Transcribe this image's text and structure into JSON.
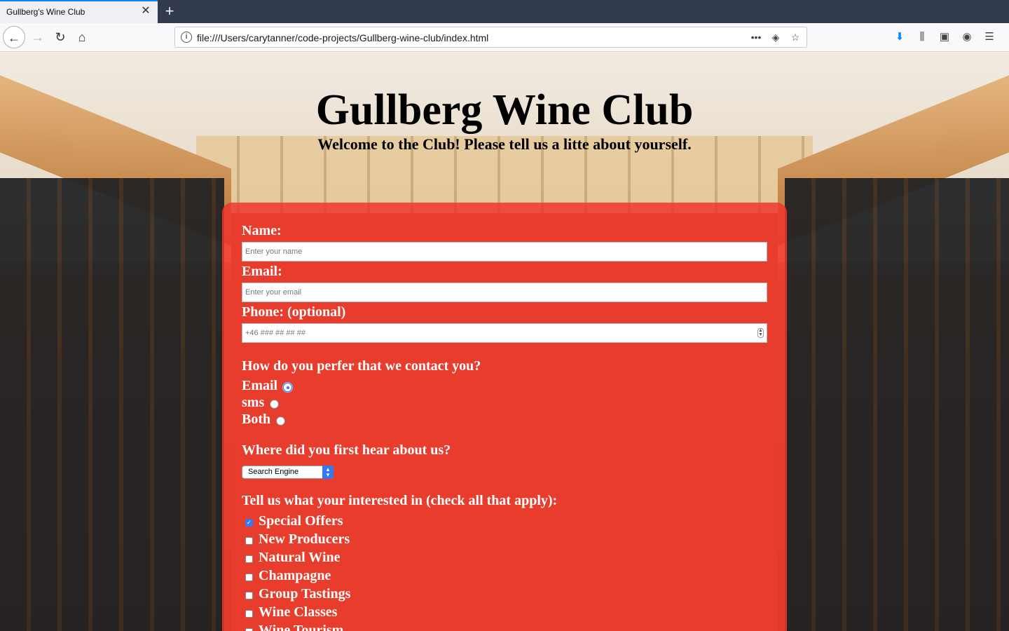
{
  "browser": {
    "tab_title": "Gullberg's Wine Club",
    "tab_close": "✕",
    "new_tab": "+",
    "url": "file:///Users/carytanner/code-projects/Gullberg-wine-club/index.html",
    "icons": {
      "back": "←",
      "forward": "→",
      "reload": "↻",
      "home": "⌂",
      "info": "i",
      "more": "•••",
      "pocket": "◈",
      "bookmark": "☆",
      "download": "⬇",
      "library": "⫼",
      "sidebar": "▣",
      "account": "◉",
      "menu": "☰"
    }
  },
  "page": {
    "title": "Gullberg Wine Club",
    "subtitle": "Welcome to the Club! Please tell us a litte about yourself."
  },
  "form": {
    "name_label": "Name:",
    "name_placeholder": "Enter your name",
    "email_label": "Email:",
    "email_placeholder": "Enter your email",
    "phone_label": "Phone: (optional)",
    "phone_placeholder": "+46 ### ## ## ##",
    "contact_question": "How do you perfer that we contact you?",
    "contact_options": [
      {
        "label": "Email",
        "selected": true
      },
      {
        "label": "sms",
        "selected": false
      },
      {
        "label": "Both",
        "selected": false
      }
    ],
    "source_question": "Where did you first hear about us?",
    "source_selected": "Search Engine",
    "interests_question": "Tell us what your interested in (check all that apply):",
    "interests": [
      {
        "label": "Special Offers",
        "checked": true
      },
      {
        "label": "New Producers",
        "checked": false
      },
      {
        "label": "Natural Wine",
        "checked": false
      },
      {
        "label": "Champagne",
        "checked": false
      },
      {
        "label": "Group Tastings",
        "checked": false
      },
      {
        "label": "Wine Classes",
        "checked": false
      },
      {
        "label": "Wine Tourism",
        "checked": false
      }
    ]
  },
  "colors": {
    "panel": "#f0372d",
    "accent": "#3478f6"
  }
}
